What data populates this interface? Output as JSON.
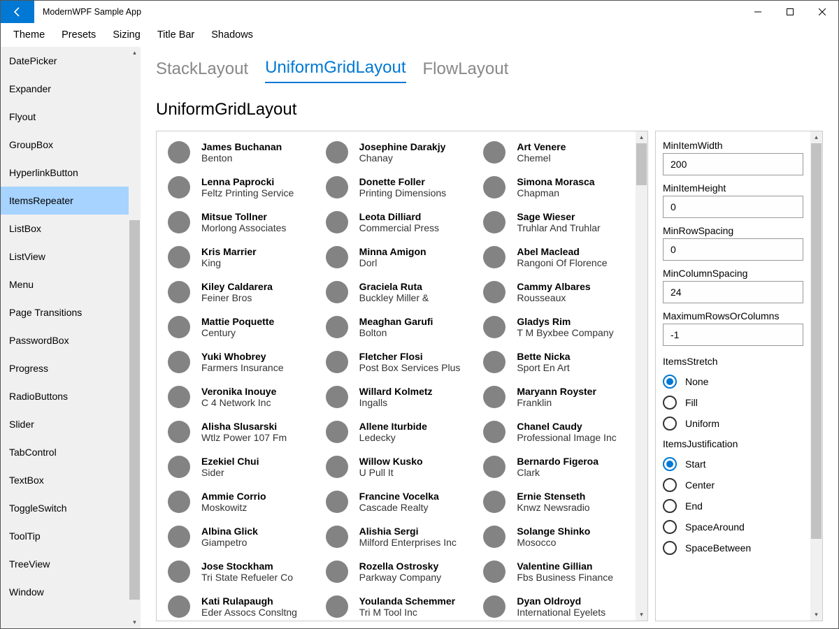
{
  "window": {
    "title": "ModernWPF Sample App"
  },
  "menubar": [
    "Theme",
    "Presets",
    "Sizing",
    "Title Bar",
    "Shadows"
  ],
  "sidebar": {
    "items": [
      "DatePicker",
      "Expander",
      "Flyout",
      "GroupBox",
      "HyperlinkButton",
      "ItemsRepeater",
      "ListBox",
      "ListView",
      "Menu",
      "Page Transitions",
      "PasswordBox",
      "Progress",
      "RadioButtons",
      "Slider",
      "TabControl",
      "TextBox",
      "ToggleSwitch",
      "ToolTip",
      "TreeView",
      "Window"
    ],
    "selected_index": 5
  },
  "tabs": {
    "items": [
      "StackLayout",
      "UniformGridLayout",
      "FlowLayout"
    ],
    "selected_index": 1
  },
  "page": {
    "heading": "UniformGridLayout"
  },
  "people": [
    {
      "name": "James Buchanan",
      "sub": "Benton"
    },
    {
      "name": "Josephine Darakjy",
      "sub": "Chanay"
    },
    {
      "name": "Art Venere",
      "sub": "Chemel"
    },
    {
      "name": "Lenna Paprocki",
      "sub": "Feltz Printing Service"
    },
    {
      "name": "Donette Foller",
      "sub": "Printing Dimensions"
    },
    {
      "name": "Simona Morasca",
      "sub": "Chapman"
    },
    {
      "name": "Mitsue Tollner",
      "sub": "Morlong Associates"
    },
    {
      "name": "Leota Dilliard",
      "sub": "Commercial Press"
    },
    {
      "name": "Sage Wieser",
      "sub": "Truhlar And Truhlar"
    },
    {
      "name": "Kris Marrier",
      "sub": "King"
    },
    {
      "name": "Minna Amigon",
      "sub": "Dorl"
    },
    {
      "name": "Abel Maclead",
      "sub": "Rangoni Of Florence"
    },
    {
      "name": "Kiley Caldarera",
      "sub": "Feiner Bros"
    },
    {
      "name": "Graciela Ruta",
      "sub": "Buckley Miller &"
    },
    {
      "name": "Cammy Albares",
      "sub": "Rousseaux"
    },
    {
      "name": "Mattie Poquette",
      "sub": "Century"
    },
    {
      "name": "Meaghan Garufi",
      "sub": "Bolton"
    },
    {
      "name": "Gladys Rim",
      "sub": "T M Byxbee Company"
    },
    {
      "name": "Yuki Whobrey",
      "sub": "Farmers Insurance"
    },
    {
      "name": "Fletcher Flosi",
      "sub": "Post Box Services Plus"
    },
    {
      "name": "Bette Nicka",
      "sub": "Sport En Art"
    },
    {
      "name": "Veronika Inouye",
      "sub": "C 4 Network Inc"
    },
    {
      "name": "Willard Kolmetz",
      "sub": "Ingalls"
    },
    {
      "name": "Maryann Royster",
      "sub": "Franklin"
    },
    {
      "name": "Alisha Slusarski",
      "sub": "Wtlz Power 107 Fm"
    },
    {
      "name": "Allene Iturbide",
      "sub": "Ledecky"
    },
    {
      "name": "Chanel Caudy",
      "sub": "Professional Image Inc"
    },
    {
      "name": "Ezekiel Chui",
      "sub": "Sider"
    },
    {
      "name": "Willow Kusko",
      "sub": "U Pull It"
    },
    {
      "name": "Bernardo Figeroa",
      "sub": "Clark"
    },
    {
      "name": "Ammie Corrio",
      "sub": "Moskowitz"
    },
    {
      "name": "Francine Vocelka",
      "sub": "Cascade Realty"
    },
    {
      "name": "Ernie Stenseth",
      "sub": "Knwz Newsradio"
    },
    {
      "name": "Albina Glick",
      "sub": "Giampetro"
    },
    {
      "name": "Alishia Sergi",
      "sub": "Milford Enterprises Inc"
    },
    {
      "name": "Solange Shinko",
      "sub": "Mosocco"
    },
    {
      "name": "Jose Stockham",
      "sub": "Tri State Refueler Co"
    },
    {
      "name": "Rozella Ostrosky",
      "sub": "Parkway Company"
    },
    {
      "name": "Valentine Gillian",
      "sub": "Fbs Business Finance"
    },
    {
      "name": "Kati Rulapaugh",
      "sub": "Eder Assocs Consltng"
    },
    {
      "name": "Youlanda Schemmer",
      "sub": "Tri M Tool Inc"
    },
    {
      "name": "Dyan Oldroyd",
      "sub": "International Eyelets"
    }
  ],
  "props": {
    "fields": [
      {
        "label": "MinItemWidth",
        "value": "200"
      },
      {
        "label": "MinItemHeight",
        "value": "0"
      },
      {
        "label": "MinRowSpacing",
        "value": "0"
      },
      {
        "label": "MinColumnSpacing",
        "value": "24"
      },
      {
        "label": "MaximumRowsOrColumns",
        "value": "-1"
      }
    ],
    "groups": [
      {
        "label": "ItemsStretch",
        "options": [
          "None",
          "Fill",
          "Uniform"
        ],
        "selected": 0
      },
      {
        "label": "ItemsJustification",
        "options": [
          "Start",
          "Center",
          "End",
          "SpaceAround",
          "SpaceBetween"
        ],
        "selected": 0
      }
    ]
  }
}
